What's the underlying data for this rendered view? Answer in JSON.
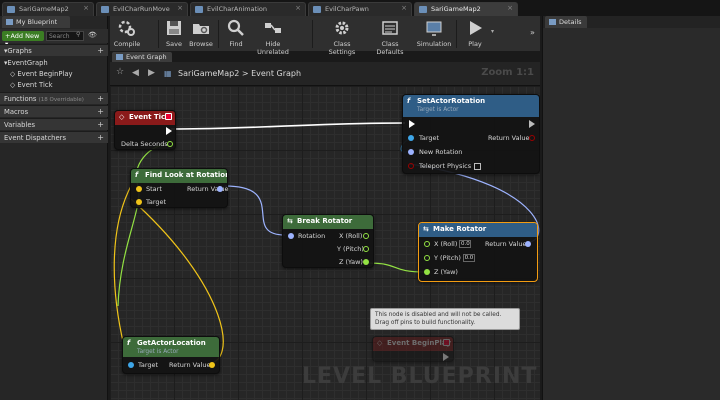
{
  "tabs": [
    {
      "label": "SariGameMap2",
      "active": false
    },
    {
      "label": "EvilCharRunMove",
      "active": false
    },
    {
      "label": "EvilCharAnimation",
      "active": false
    },
    {
      "label": "EvilCharPawn",
      "active": false
    },
    {
      "label": "SariGameMap2",
      "active": true
    }
  ],
  "toolbar": {
    "buttons": [
      {
        "label": "Compile",
        "icon": "compile-icon"
      },
      {
        "label": "Save",
        "icon": "save-icon"
      },
      {
        "label": "Browse",
        "icon": "browse-icon"
      },
      {
        "label": "Find",
        "icon": "find-icon"
      },
      {
        "label": "Hide Unrelated",
        "icon": "hide-unrelated-icon"
      },
      {
        "label": "Class Settings",
        "icon": "class-settings-icon"
      },
      {
        "label": "Class Defaults",
        "icon": "class-defaults-icon"
      },
      {
        "label": "Simulation",
        "icon": "simulation-icon"
      },
      {
        "label": "Play",
        "icon": "play-icon"
      }
    ],
    "more": "»"
  },
  "left_panel": {
    "tab_label": "My Blueprint",
    "add_new_label": "+Add New ▾",
    "search_placeholder": "Search",
    "graphs_header": "Graphs",
    "graph_items": [
      "EventGraph",
      "Event BeginPlay",
      "Event Tick"
    ],
    "functions_header": "Functions",
    "functions_count": "(18 Overridable)",
    "macros_header": "Macros",
    "variables_header": "Variables",
    "dispatchers_header": "Event Dispatchers"
  },
  "graph": {
    "tab_label": "Event Graph",
    "breadcrumb_map": "SariGameMap2",
    "breadcrumb_sep": ">",
    "breadcrumb_graph": "Event Graph",
    "zoom": "Zoom 1:1",
    "watermark": "LEVEL BLUEPRINT"
  },
  "nodes": {
    "event_tick": {
      "title": "Event Tick",
      "pin_delta": "Delta Seconds"
    },
    "set_actor_rotation": {
      "title": "SetActorRotation",
      "subtitle": "Target is Actor",
      "pin_target": "Target",
      "pin_new_rotation": "New Rotation",
      "pin_teleport": "Teleport Physics",
      "pin_return": "Return Value"
    },
    "find_look_at": {
      "title": "Find Look at Rotation",
      "pin_start": "Start",
      "pin_target": "Target",
      "pin_return": "Return Value"
    },
    "break_rotator": {
      "title": "Break Rotator",
      "pin_rotation": "Rotation",
      "pin_roll": "X (Roll)",
      "pin_pitch": "Y (Pitch)",
      "pin_yaw": "Z (Yaw)"
    },
    "make_rotator": {
      "title": "Make Rotator",
      "pin_roll": "X (Roll)",
      "roll_value": "0.0",
      "pin_pitch": "Y (Pitch)",
      "pitch_value": "0.0",
      "pin_yaw": "Z (Yaw)",
      "pin_return": "Return Value"
    },
    "get_actor_location": {
      "title": "GetActorLocation",
      "subtitle": "Target is Actor",
      "pin_target": "Target",
      "pin_return": "Return Value"
    },
    "event_beginplay": {
      "title": "Event BeginPlay",
      "tooltip": "This node is disabled and will not be called. Drag off pins to build functionality."
    }
  },
  "details": {
    "tab_label": "Details"
  },
  "colors": {
    "event_red": "#8a1a1a",
    "function_blue": "#2f5d86",
    "pure_green": "#3d6b3a",
    "vector_yellow": "#f0c419",
    "rotator_blue": "#9db3ff",
    "float_green": "#93e243",
    "object_blue": "#3ea6e8",
    "bool_red": "#9b0000",
    "selection_orange": "#f39c12"
  }
}
